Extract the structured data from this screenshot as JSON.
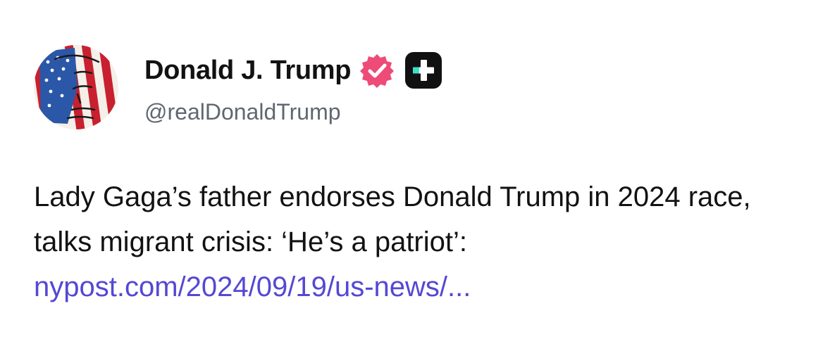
{
  "author": {
    "display_name": "Donald J. Trump",
    "handle": "@realDonaldTrump",
    "avatar_icon": "flag-portrait-avatar",
    "verified_icon": "verified-badge-icon",
    "subscriber_icon": "plus-badge-icon"
  },
  "post": {
    "text": "Lady Gaga’s father endorses Donald Trump in 2024 race, talks migrant crisis: ‘He’s a patriot’: ",
    "link": "nypost.com/2024/09/19/us-news/..."
  },
  "colors": {
    "text": "#121212",
    "muted": "#606770",
    "link": "#5448d3",
    "verified_badge": "#ee4b78",
    "plus_badge": "#111111",
    "plus_accent": "#3de0c8"
  }
}
